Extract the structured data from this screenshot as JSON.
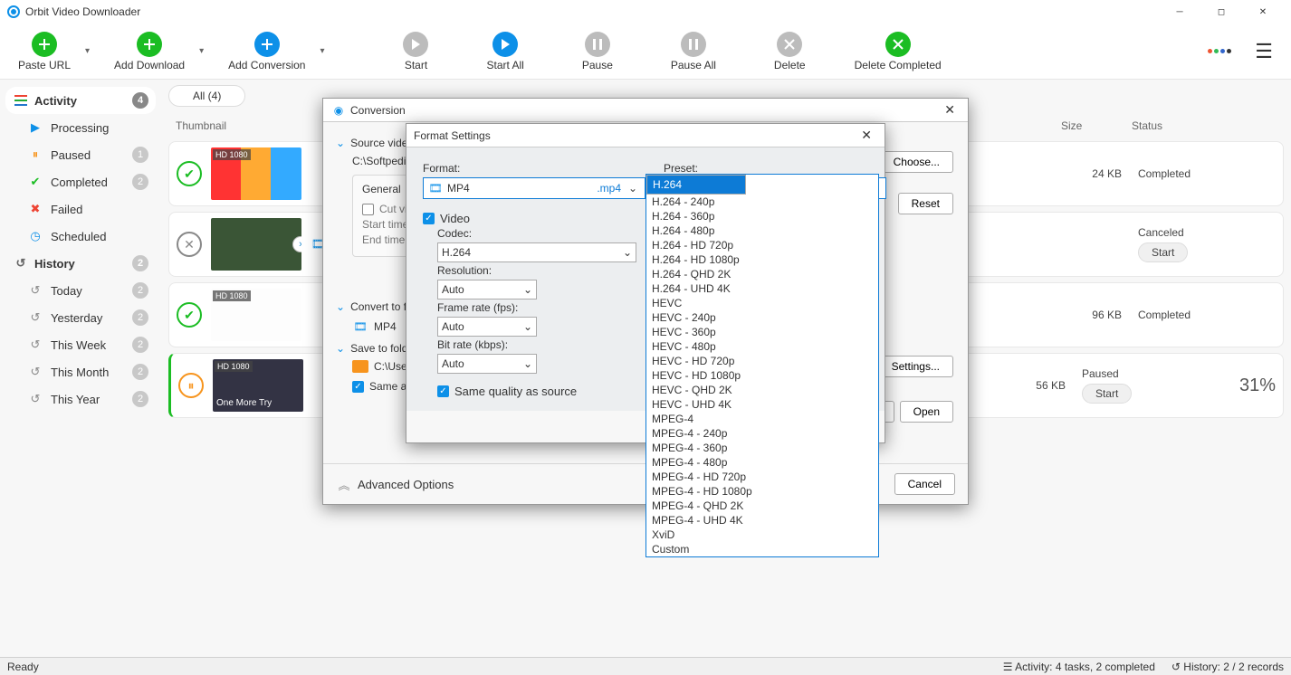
{
  "app": {
    "title": "Orbit Video Downloader"
  },
  "toolbar": {
    "paste": "Paste URL",
    "addDownload": "Add Download",
    "addConversion": "Add Conversion",
    "start": "Start",
    "startAll": "Start All",
    "pause": "Pause",
    "pauseAll": "Pause All",
    "delete": "Delete",
    "deleteCompleted": "Delete Completed"
  },
  "sidebar": {
    "activity": {
      "label": "Activity",
      "badge": "4"
    },
    "processing": "Processing",
    "paused": {
      "label": "Paused",
      "badge": "1"
    },
    "completed": {
      "label": "Completed",
      "badge": "2"
    },
    "failed": "Failed",
    "scheduled": "Scheduled",
    "history": {
      "label": "History",
      "badge": "2"
    },
    "today": {
      "label": "Today",
      "badge": "2"
    },
    "yesterday": {
      "label": "Yesterday",
      "badge": "2"
    },
    "week": {
      "label": "This Week",
      "badge": "2"
    },
    "month": {
      "label": "This Month",
      "badge": "2"
    },
    "year": {
      "label": "This Year",
      "badge": "2"
    }
  },
  "scope": {
    "all": "All (4)"
  },
  "headers": {
    "thumb": "Thumbnail",
    "size": "Size",
    "status": "Status"
  },
  "tasks": {
    "t1": {
      "tag": "HD 1080",
      "size": "24 KB",
      "status": "Completed"
    },
    "t2": {
      "tag": "",
      "size": "",
      "status": "Canceled",
      "btn": "Start"
    },
    "t3": {
      "tag": "HD 1080",
      "size": "96 KB",
      "status": "Completed"
    },
    "t4": {
      "tag": "HD 1080",
      "title": "One More Try",
      "size": "56 KB",
      "status": "Paused",
      "btn": "Start",
      "pct": "31%"
    }
  },
  "statusbar": {
    "ready": "Ready",
    "activity": "Activity: 4 tasks, 2 completed",
    "history": "History: 2 / 2 records"
  },
  "dlgConv": {
    "title": "Conversion",
    "src": "Source video",
    "srcPath": "C:\\Softpedi",
    "general": "General",
    "cut": "Cut vid",
    "startTime": "Start time:",
    "endTime": "End time:",
    "convTo": "Convert to fo",
    "convFmt": "MP4",
    "saveTo": "Save to folde",
    "savePath": "C:\\User",
    "sameAs": "Same as i",
    "adv": "Advanced Options",
    "choose": "Choose...",
    "reset": "Reset",
    "settings": "Settings...",
    "ell": "...",
    "open": "Open",
    "cancel": "Cancel"
  },
  "dlgFmt": {
    "title": "Format Settings",
    "format": "Format:",
    "fmtVal": "MP4",
    "fmtExt": ".mp4",
    "preset": "Preset:",
    "presetVal": "H.264",
    "video": "Video",
    "codec": "Codec:",
    "codecVal": "H.264",
    "res": "Resolution:",
    "resVal": "Auto",
    "fps": "Frame rate (fps):",
    "fpsVal": "Auto",
    "bitrate": "Bit rate (kbps):",
    "bitrateVal": "Auto",
    "same": "Same quality as source"
  },
  "presets": [
    "H.264",
    "H.264 - 240p",
    "H.264 - 360p",
    "H.264 - 480p",
    "H.264 - HD 720p",
    "H.264 - HD 1080p",
    "H.264 - QHD 2K",
    "H.264 - UHD 4K",
    "HEVC",
    "HEVC - 240p",
    "HEVC - 360p",
    "HEVC - 480p",
    "HEVC - HD 720p",
    "HEVC - HD 1080p",
    "HEVC - QHD 2K",
    "HEVC - UHD 4K",
    "MPEG-4",
    "MPEG-4 - 240p",
    "MPEG-4 - 360p",
    "MPEG-4 - 480p",
    "MPEG-4 - HD 720p",
    "MPEG-4 - HD 1080p",
    "MPEG-4 - QHD 2K",
    "MPEG-4 - UHD 4K",
    "XviD",
    "Custom"
  ]
}
